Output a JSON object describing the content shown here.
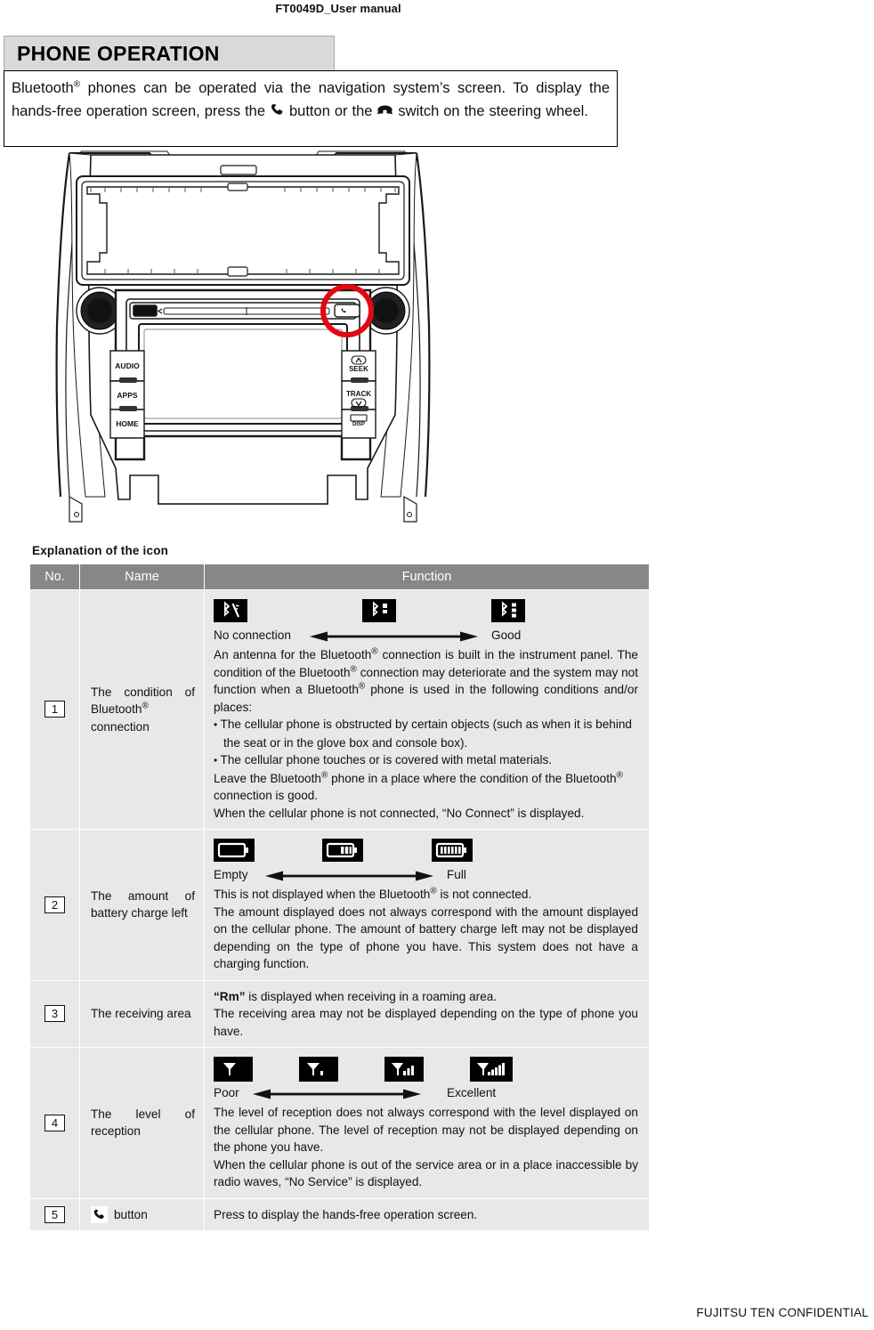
{
  "running_head": "FT0049D_User manual",
  "section": {
    "title": "PHONE OPERATION",
    "intro_part1": "Bluetooth",
    "intro_reg": "®",
    "intro_part2": " phones can be operated via the navigation system’s screen. To display the hands-free operation screen, press the ",
    "intro_part3": " button or the ",
    "intro_part4": " switch on the steering wheel.",
    "handset_icon_name": "handset-icon",
    "steering_switch_icon_name": "telephone-switch-icon"
  },
  "dashboard": {
    "caption_alt": "Instrument panel illustration with phone button circled in red",
    "left_buttons": [
      "AUDIO",
      "APPS",
      "HOME"
    ],
    "right_buttons": [
      "SEEK",
      "TRACK",
      "DISP"
    ],
    "highlight_color": "#e30613",
    "highlighted_button": "phone-button"
  },
  "explanation_caption": "Explanation of the icon",
  "table": {
    "headers": [
      "No.",
      "Name",
      "Function"
    ],
    "rows": [
      {
        "no": "1",
        "name_part1": "The condition of Bluetooth",
        "name_reg": "®",
        "name_part2": " connection",
        "icons": [
          "bluetooth-no-connection-icon",
          "bluetooth-fair-icon",
          "bluetooth-good-icon"
        ],
        "range_left": "No connection",
        "range_right": "Good",
        "paragraphs": [
          "An antenna for the Bluetooth® connection is built in the instrument panel. The condition of the Bluetooth® connection may deteriorate and the system may not function when a Bluetooth® phone is used in the following conditions and/or places:"
        ],
        "bullets": [
          "The cellular phone is obstructed by certain objects (such as when it is behind the seat or in the glove box and console box).",
          "The cellular phone touches or is covered with metal materials."
        ],
        "paragraphs_after": [
          "Leave the Bluetooth® phone in a place where the condition of the Bluetooth® connection is good.",
          "When the cellular phone is not connected, “No Connect” is displayed."
        ]
      },
      {
        "no": "2",
        "name": "The amount of battery charge left",
        "icons": [
          "battery-empty-icon",
          "battery-half-icon",
          "battery-full-icon"
        ],
        "range_left": "Empty",
        "range_right": "Full",
        "paragraphs": [
          "This is not displayed when the Bluetooth® is not connected.",
          "The amount displayed does not always correspond with the amount displayed on the cellular phone. The amount of battery charge left may not be displayed depending on the type of phone you have. This system does not have a charging function."
        ]
      },
      {
        "no": "3",
        "name": "The receiving area",
        "rm_label": "“Rm”",
        "paragraphs": [
          " is displayed when receiving in a roaming area.",
          "The receiving area may not be displayed depending on the type of phone you have."
        ]
      },
      {
        "no": "4",
        "name": "The level of reception",
        "icons": [
          "signal-0-bars-icon",
          "signal-1-bar-icon",
          "signal-3-bars-icon",
          "signal-5-bars-icon"
        ],
        "range_left": "Poor",
        "range_right": "Excellent",
        "paragraphs": [
          "The level of reception does not always correspond with the level displayed on the cellular phone. The level of reception may not be displayed depending on the phone you have.",
          "When the cellular phone is out of the service area or in a place inaccessible by radio waves, “No Service” is displayed."
        ]
      },
      {
        "no": "5",
        "name_suffix": "button",
        "name_icon": "handset-icon",
        "function": "Press to display the hands-free operation screen."
      }
    ]
  },
  "footer": "FUJITSU TEN CONFIDENTIAL"
}
